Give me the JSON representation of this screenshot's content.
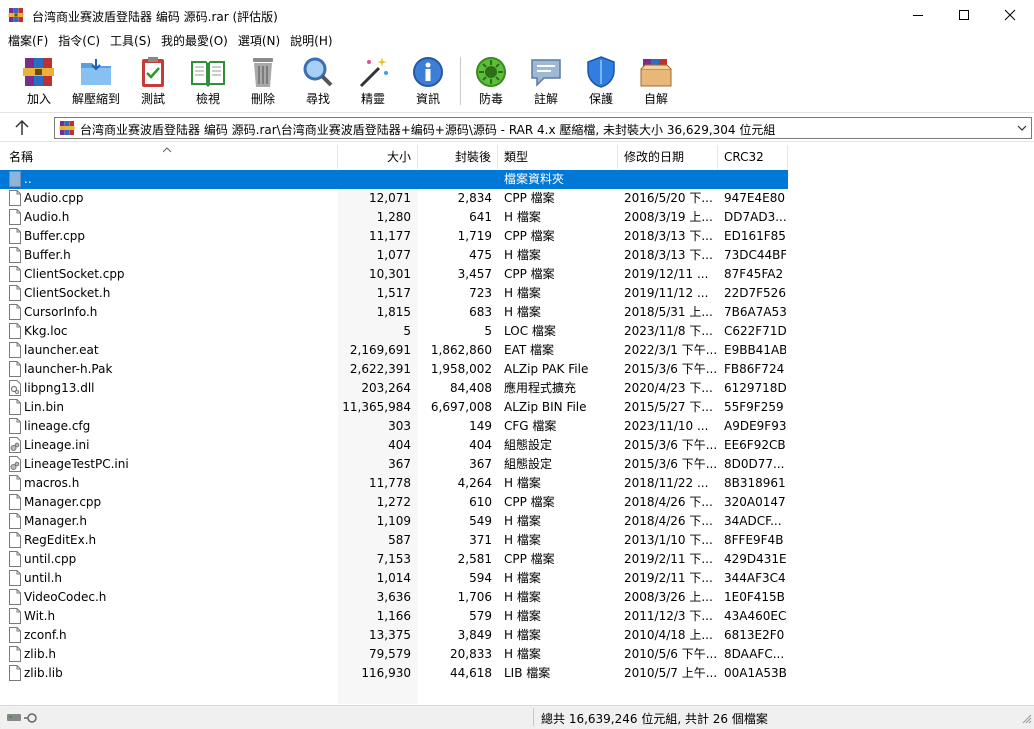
{
  "window": {
    "title": "台湾商业赛波盾登陆器 编码 源码.rar (評估版)"
  },
  "menu": [
    "檔案(F)",
    "指令(C)",
    "工具(S)",
    "我的最愛(O)",
    "選項(N)",
    "說明(H)"
  ],
  "toolbar": [
    {
      "label": "加入",
      "icon": "winrar-add-icon"
    },
    {
      "label": "解壓縮到",
      "icon": "folder-extract-icon"
    },
    {
      "label": "測試",
      "icon": "clipboard-check-icon"
    },
    {
      "label": "檢視",
      "icon": "book-view-icon"
    },
    {
      "label": "刪除",
      "icon": "trash-icon"
    },
    {
      "label": "尋找",
      "icon": "magnifier-icon"
    },
    {
      "label": "精靈",
      "icon": "wand-icon"
    },
    {
      "label": "資訊",
      "icon": "info-icon"
    },
    {
      "label": "防毒",
      "icon": "virus-icon"
    },
    {
      "label": "註解",
      "icon": "comment-icon"
    },
    {
      "label": "保護",
      "icon": "shield-icon"
    },
    {
      "label": "自解",
      "icon": "sfx-box-icon"
    }
  ],
  "address": {
    "path": "台湾商业赛波盾登陆器 编码 源码.rar\\台湾商业赛波盾登陆器+编码+源码\\源码 - RAR 4.x 壓縮檔, 未封裝大小 36,629,304 位元組"
  },
  "columns": {
    "name": "名稱",
    "size": "大小",
    "packed": "封裝後",
    "type": "類型",
    "modified": "修改的日期",
    "crc": "CRC32"
  },
  "files": [
    {
      "name": "..",
      "size": "",
      "packed": "",
      "type": "檔案資料夾",
      "modified": "",
      "crc": "",
      "icon": "folder-up-icon",
      "selected": true
    },
    {
      "name": "Audio.cpp",
      "size": "12,071",
      "packed": "2,834",
      "type": "CPP 檔案",
      "modified": "2016/5/20 下...",
      "crc": "947E4E80",
      "icon": "file-icon"
    },
    {
      "name": "Audio.h",
      "size": "1,280",
      "packed": "641",
      "type": "H 檔案",
      "modified": "2008/3/19 上...",
      "crc": "DD7AD3...",
      "icon": "file-icon"
    },
    {
      "name": "Buffer.cpp",
      "size": "11,177",
      "packed": "1,719",
      "type": "CPP 檔案",
      "modified": "2018/3/13 下...",
      "crc": "ED161F85",
      "icon": "file-icon"
    },
    {
      "name": "Buffer.h",
      "size": "1,077",
      "packed": "475",
      "type": "H 檔案",
      "modified": "2018/3/13 下...",
      "crc": "73DC44BF",
      "icon": "file-icon"
    },
    {
      "name": "ClientSocket.cpp",
      "size": "10,301",
      "packed": "3,457",
      "type": "CPP 檔案",
      "modified": "2019/12/11 ...",
      "crc": "87F45FA2",
      "icon": "file-icon"
    },
    {
      "name": "ClientSocket.h",
      "size": "1,517",
      "packed": "723",
      "type": "H 檔案",
      "modified": "2019/11/12 ...",
      "crc": "22D7F526",
      "icon": "file-icon"
    },
    {
      "name": "CursorInfo.h",
      "size": "1,815",
      "packed": "683",
      "type": "H 檔案",
      "modified": "2018/5/31 上...",
      "crc": "7B6A7A53",
      "icon": "file-icon"
    },
    {
      "name": "Kkg.loc",
      "size": "5",
      "packed": "5",
      "type": "LOC 檔案",
      "modified": "2023/11/8 下...",
      "crc": "C622F71D",
      "icon": "file-icon"
    },
    {
      "name": "launcher.eat",
      "size": "2,169,691",
      "packed": "1,862,860",
      "type": "EAT 檔案",
      "modified": "2022/3/1 下午...",
      "crc": "E9BB41AB",
      "icon": "file-icon"
    },
    {
      "name": "launcher-h.Pak",
      "size": "2,622,391",
      "packed": "1,958,002",
      "type": "ALZip PAK File",
      "modified": "2015/3/6 下午...",
      "crc": "FB86F724",
      "icon": "file-icon"
    },
    {
      "name": "libpng13.dll",
      "size": "203,264",
      "packed": "84,408",
      "type": "應用程式擴充",
      "modified": "2020/4/23 下...",
      "crc": "6129718D",
      "icon": "dll-icon"
    },
    {
      "name": "Lin.bin",
      "size": "11,365,984",
      "packed": "6,697,008",
      "type": "ALZip BIN File",
      "modified": "2015/5/27 下...",
      "crc": "55F9F259",
      "icon": "file-icon"
    },
    {
      "name": "lineage.cfg",
      "size": "303",
      "packed": "149",
      "type": "CFG 檔案",
      "modified": "2023/11/10 ...",
      "crc": "A9DE9F93",
      "icon": "file-icon"
    },
    {
      "name": "Lineage.ini",
      "size": "404",
      "packed": "404",
      "type": "組態設定",
      "modified": "2015/3/6 下午...",
      "crc": "EE6F92CB",
      "icon": "ini-icon"
    },
    {
      "name": "LineageTestPC.ini",
      "size": "367",
      "packed": "367",
      "type": "組態設定",
      "modified": "2015/3/6 下午...",
      "crc": "8D0D77...",
      "icon": "ini-icon"
    },
    {
      "name": "macros.h",
      "size": "11,778",
      "packed": "4,264",
      "type": "H 檔案",
      "modified": "2018/11/22 ...",
      "crc": "8B318961",
      "icon": "file-icon"
    },
    {
      "name": "Manager.cpp",
      "size": "1,272",
      "packed": "610",
      "type": "CPP 檔案",
      "modified": "2018/4/26 下...",
      "crc": "320A0147",
      "icon": "file-icon"
    },
    {
      "name": "Manager.h",
      "size": "1,109",
      "packed": "549",
      "type": "H 檔案",
      "modified": "2018/4/26 下...",
      "crc": "34ADCF...",
      "icon": "file-icon"
    },
    {
      "name": "RegEditEx.h",
      "size": "587",
      "packed": "371",
      "type": "H 檔案",
      "modified": "2013/1/10 下...",
      "crc": "8FFE9F4B",
      "icon": "file-icon"
    },
    {
      "name": "until.cpp",
      "size": "7,153",
      "packed": "2,581",
      "type": "CPP 檔案",
      "modified": "2019/2/11 下...",
      "crc": "429D431E",
      "icon": "file-icon"
    },
    {
      "name": "until.h",
      "size": "1,014",
      "packed": "594",
      "type": "H 檔案",
      "modified": "2019/2/11 下...",
      "crc": "344AF3C4",
      "icon": "file-icon"
    },
    {
      "name": "VideoCodec.h",
      "size": "3,636",
      "packed": "1,706",
      "type": "H 檔案",
      "modified": "2008/3/26 上...",
      "crc": "1E0F415B",
      "icon": "file-icon"
    },
    {
      "name": "Wit.h",
      "size": "1,166",
      "packed": "579",
      "type": "H 檔案",
      "modified": "2011/12/3 下...",
      "crc": "43A460EC",
      "icon": "file-icon"
    },
    {
      "name": "zconf.h",
      "size": "13,375",
      "packed": "3,849",
      "type": "H 檔案",
      "modified": "2010/4/18 上...",
      "crc": "6813E2F0",
      "icon": "file-icon"
    },
    {
      "name": "zlib.h",
      "size": "79,579",
      "packed": "20,833",
      "type": "H 檔案",
      "modified": "2010/5/6 下午...",
      "crc": "8DAAFC...",
      "icon": "file-icon"
    },
    {
      "name": "zlib.lib",
      "size": "116,930",
      "packed": "44,618",
      "type": "LIB 檔案",
      "modified": "2010/5/7 上午...",
      "crc": "00A1A53B",
      "icon": "file-icon"
    }
  ],
  "status": {
    "summary": "總共 16,639,246 位元組, 共計 26 個檔案"
  },
  "colors": {
    "selection": "#0078d7",
    "folder": "#8fb4d9"
  }
}
